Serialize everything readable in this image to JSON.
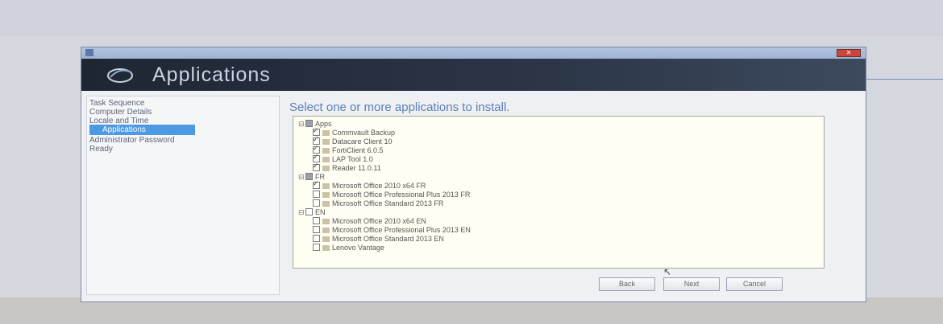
{
  "window": {
    "titlebar_text": "",
    "header_title": "Applications"
  },
  "sidebar": {
    "items": [
      {
        "label": "Task Sequence",
        "active": false
      },
      {
        "label": "Computer Details",
        "active": false
      },
      {
        "label": "Locale and Time",
        "active": false
      },
      {
        "label": "Applications",
        "active": true
      },
      {
        "label": "Administrator Password",
        "active": false
      },
      {
        "label": "Ready",
        "active": false
      }
    ]
  },
  "main": {
    "instruction": "Select one or more applications to install.",
    "tree": {
      "groups": [
        {
          "label": "Apps",
          "state": "partial",
          "items": [
            {
              "label": "Commvault Backup",
              "checked": true
            },
            {
              "label": "Datacare Client 10",
              "checked": true
            },
            {
              "label": "FortiClient 6.0.5",
              "checked": true
            },
            {
              "label": "LAP Tool 1.0",
              "checked": true
            },
            {
              "label": "Reader 11.0.11",
              "checked": true
            }
          ]
        },
        {
          "label": "FR",
          "state": "partial",
          "items": [
            {
              "label": "Microsoft Office 2010 x64 FR",
              "checked": true
            },
            {
              "label": "Microsoft Office Professional Plus 2013 FR",
              "checked": false
            },
            {
              "label": "Microsoft Office Standard 2013 FR",
              "checked": false
            }
          ]
        },
        {
          "label": "EN",
          "state": "unchecked",
          "items": [
            {
              "label": "Microsoft Office 2010 x64 EN",
              "checked": false
            },
            {
              "label": "Microsoft Office Professional Plus 2013 EN",
              "checked": false
            },
            {
              "label": "Microsoft Office Standard 2013 EN",
              "checked": false
            },
            {
              "label": "Lenovo Vantage",
              "checked": false
            }
          ]
        }
      ]
    }
  },
  "buttons": {
    "back": "Back",
    "next": "Next",
    "cancel": "Cancel"
  },
  "colors": {
    "header_bg": "#1e2633",
    "selection": "#4d9ae3",
    "instruction": "#5b7fb6",
    "tree_bg": "#fffef3"
  }
}
